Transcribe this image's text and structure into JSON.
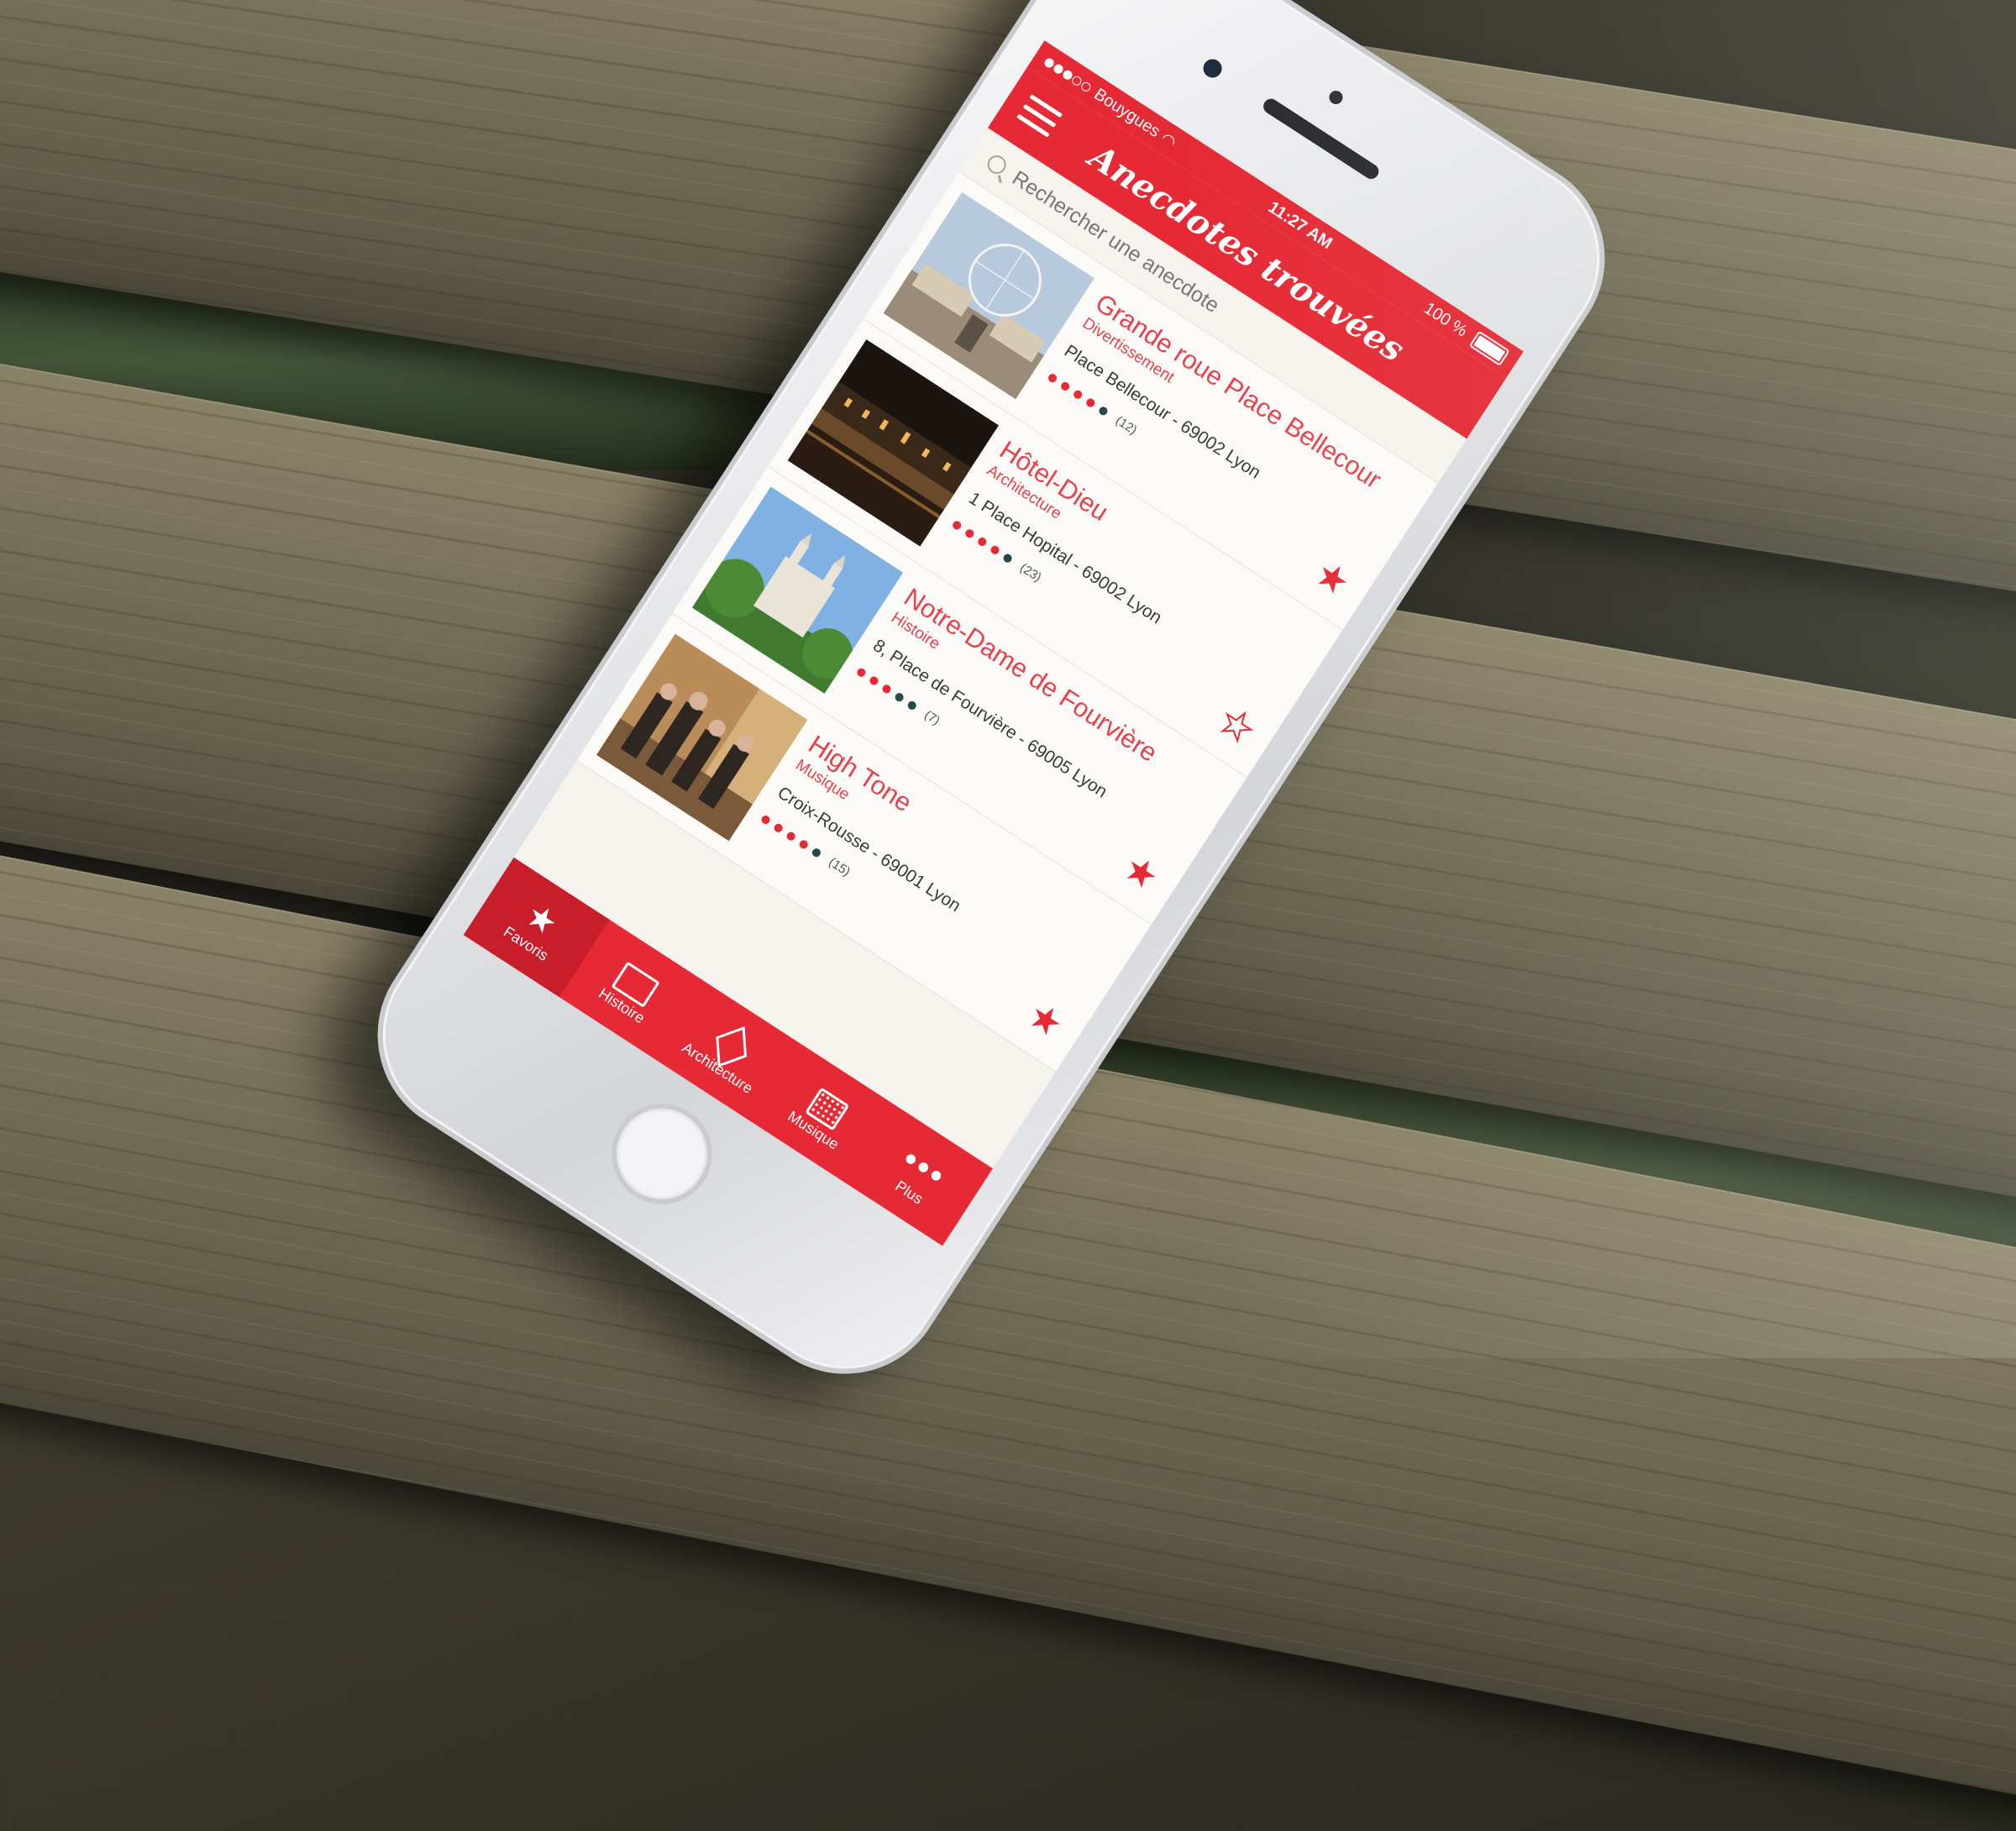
{
  "status": {
    "carrier": "Bouygues",
    "time": "11:27 AM",
    "battery": "100 %"
  },
  "header": {
    "title": "Anecdotes trouvées"
  },
  "search": {
    "placeholder": "Rechercher une anecdote"
  },
  "items": [
    {
      "name": "Grande roue Place Bellecour",
      "category": "Divertissement",
      "address": "Place Bellecour - 69002 Lyon",
      "rating_count": "(12)",
      "rating": 4,
      "favorite": true
    },
    {
      "name": "Hôtel-Dieu",
      "category": "Architecture",
      "address": "1 Place Hopital - 69002 Lyon",
      "rating_count": "(23)",
      "rating": 4,
      "favorite": false
    },
    {
      "name": "Notre-Dame de Fourvière",
      "category": "Histoire",
      "address": "8, Place de Fourvière - 69005 Lyon",
      "rating_count": "(7)",
      "rating": 3,
      "favorite": true
    },
    {
      "name": "High Tone",
      "category": "Musique",
      "address": "Croix-Rousse - 69001 Lyon",
      "rating_count": "(15)",
      "rating": 4,
      "favorite": true
    }
  ],
  "tabs": [
    {
      "label": "Favoris",
      "icon": "star-icon"
    },
    {
      "label": "Histoire",
      "icon": "folder-icon"
    },
    {
      "label": "Architecture",
      "icon": "cube-icon"
    },
    {
      "label": "Musique",
      "icon": "radio-icon"
    },
    {
      "label": "Plus",
      "icon": "more-icon"
    }
  ],
  "colors": {
    "accent": "#e52a35",
    "background": "#f6f3ee"
  }
}
